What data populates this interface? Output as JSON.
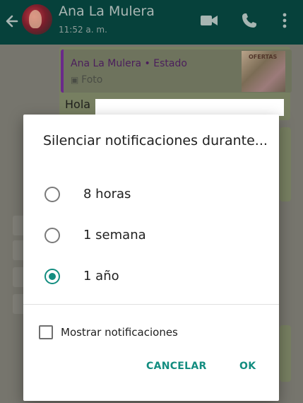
{
  "header": {
    "contact_name": "Ana La Mulera",
    "last_seen": "11:52 a. m.",
    "icons": [
      "back-arrow-icon",
      "avatar",
      "video-call-icon",
      "phone-icon",
      "more-options-icon"
    ]
  },
  "chat": {
    "quoted_status": {
      "author": "Ana La Mulera • Estado",
      "media_type": "Foto",
      "thumbnail_text": "OFERTAS"
    },
    "message_text": "Hola"
  },
  "dialog": {
    "title": "Silenciar notificaciones durante...",
    "options": [
      {
        "label": "8 horas",
        "selected": false
      },
      {
        "label": "1 semana",
        "selected": false
      },
      {
        "label": "1 año",
        "selected": true
      }
    ],
    "show_notifications_label": "Mostrar notificaciones",
    "show_notifications_checked": false,
    "cancel_label": "CANCELAR",
    "ok_label": "OK"
  },
  "colors": {
    "header_bg": "#06413b",
    "accent": "#138d80",
    "scrim": "#76756d"
  }
}
